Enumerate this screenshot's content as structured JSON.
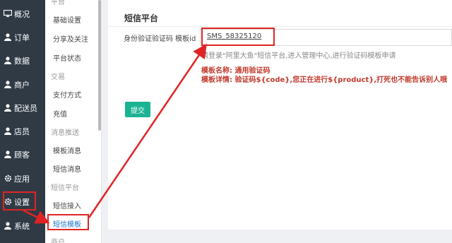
{
  "main_nav": [
    {
      "label": "概况",
      "icon": "monitor-icon"
    },
    {
      "label": "订单",
      "icon": "user-icon"
    },
    {
      "label": "数据",
      "icon": "user-icon"
    },
    {
      "label": "商户",
      "icon": "user-icon"
    },
    {
      "label": "配送员",
      "icon": "user-icon"
    },
    {
      "label": "店员",
      "icon": "user-icon"
    },
    {
      "label": "顾客",
      "icon": "user-icon"
    },
    {
      "label": "应用",
      "icon": "gear-icon"
    },
    {
      "label": "设置",
      "icon": "gear-icon"
    },
    {
      "label": "系统",
      "icon": "user-icon"
    }
  ],
  "sub_nav": {
    "top_partial": "平台",
    "items_a": [
      "基础设置",
      "分享及关注",
      "平台状态"
    ],
    "group_trade": "交易",
    "items_b": [
      "支付方式",
      "充值"
    ],
    "group_msg": "消息推送",
    "items_c": [
      "模板消息",
      "短信消息"
    ],
    "group_sms": "短信平台",
    "items_d": [
      "短信接入",
      "短信模板"
    ],
    "bottom_partial": "商户"
  },
  "page": {
    "title": "短信平台",
    "field_label": "身份验证验证码 模板id",
    "field_value": "SMS_58325120",
    "hint": "请登录\"阿里大鱼\"短信平台,进入管理中心,进行验证码模板申请",
    "template_name": "模板名称: 通用验证码",
    "template_detail": "模板详情: 验证码${code},您正在进行${product},打死也不能告诉别人哦",
    "submit_label": "提交"
  },
  "colors": {
    "sidebar_bg": "#2f3a45",
    "accent_green": "#1ab394",
    "annotation_red": "#e02424",
    "template_red": "#c0392b"
  }
}
